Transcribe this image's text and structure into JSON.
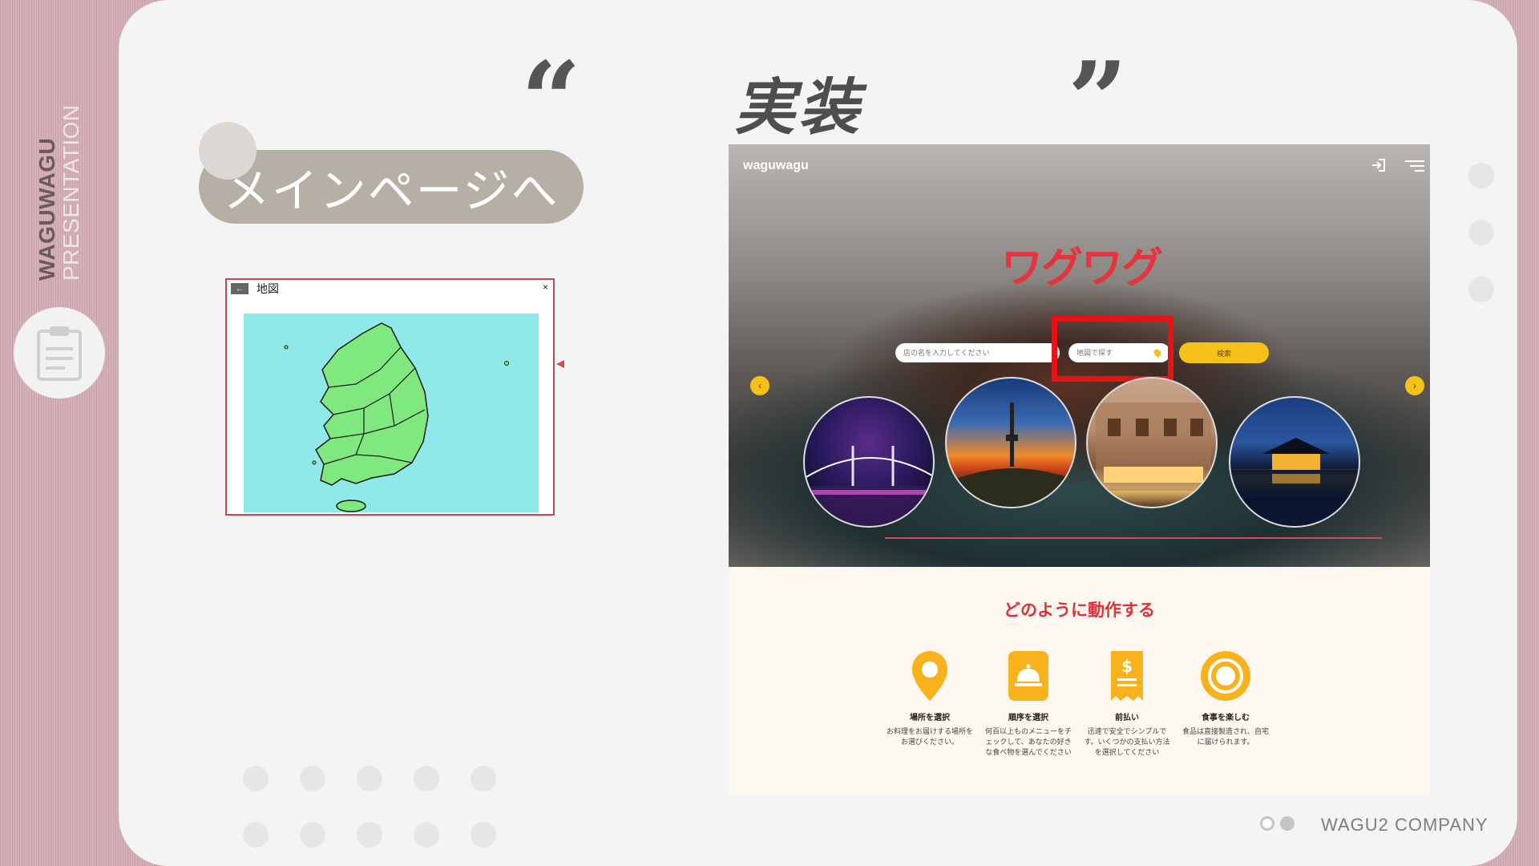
{
  "sidebar": {
    "title": "WAGUWAGU",
    "subtitle": "PRESENTATION",
    "icon": "clipboard-icon"
  },
  "slide": {
    "heading": "実装",
    "open_quote": "“",
    "close_quote": "”",
    "pill_label": "メインページへ"
  },
  "map_window": {
    "title": "地図",
    "back_label": "←",
    "close_label": "×",
    "regions": [
      "Gangwon-do",
      "Gyeonggi-do",
      "Chungcheongbuk-do",
      "Chungcheongnam-do",
      "Gyeongsangbuk-do",
      "Jeollabuk-do",
      "Gyeongsangnam-do",
      "Jeollanam-do",
      "Jeju-do"
    ]
  },
  "website": {
    "logo": "waguwagu",
    "brand_title": "ワグワグ",
    "search_placeholder": "店の名を入力してください",
    "map_search_placeholder": "地図で探す",
    "search_button": "検索",
    "nav_prev": "‹",
    "nav_next": "›",
    "how_title": "どのように動作する",
    "steps": [
      {
        "title": "場所を選択",
        "desc": "お料理をお届けする場所をお選びください。",
        "icon": "location-pin-icon"
      },
      {
        "title": "順序を選択",
        "desc": "何百以上ものメニューをチェックして、あなたの好きな食べ物を選んでください",
        "icon": "food-cloche-icon"
      },
      {
        "title": "前払い",
        "desc": "迅速で安全でシンプルです。いくつかの支払い方法を選択してください",
        "icon": "receipt-dollar-icon"
      },
      {
        "title": "食事を楽しむ",
        "desc": "食品は直接製造され、自宅に届けられます。",
        "icon": "plate-icon"
      }
    ]
  },
  "footer": {
    "company": "WAGU2 COMPANY"
  },
  "colors": {
    "accent_red": "#e63340",
    "accent_yellow": "#f6c21a",
    "highlight": "#e51414"
  }
}
